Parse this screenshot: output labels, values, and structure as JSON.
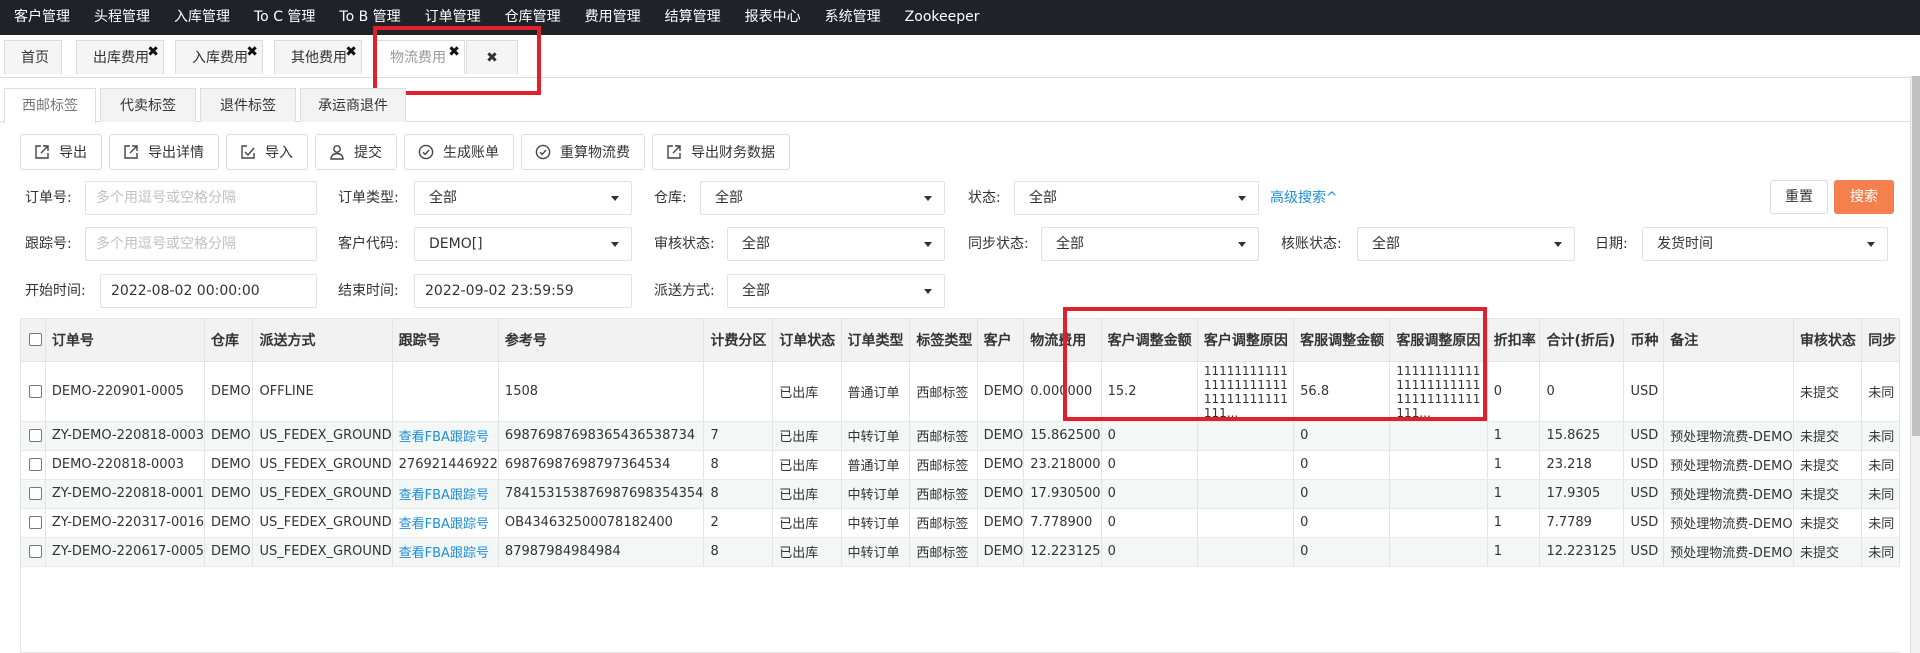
{
  "topnav": [
    "客户管理",
    "头程管理",
    "入库管理",
    "To C 管理",
    "To B 管理",
    "订单管理",
    "仓库管理",
    "费用管理",
    "结算管理",
    "报表中心",
    "系统管理",
    "Zookeeper"
  ],
  "pagetabs": {
    "home": "首页",
    "items": [
      "出库费用",
      "入库费用",
      "其他费用",
      "物流费用"
    ],
    "close_glyph": "✖"
  },
  "subtabs": [
    "西邮标签",
    "代卖标签",
    "退件标签",
    "承运商退件"
  ],
  "toolbar": [
    "导出",
    "导出详情",
    "导入",
    "提交",
    "生成账单",
    "重算物流费",
    "导出财务数据"
  ],
  "filters": {
    "order_no": {
      "label": "订单号:",
      "placeholder": "多个用逗号或空格分隔"
    },
    "order_type": {
      "label": "订单类型:",
      "value": "全部"
    },
    "warehouse": {
      "label": "仓库:",
      "value": "全部"
    },
    "status": {
      "label": "状态:",
      "value": "全部"
    },
    "advanced": "高级搜索^",
    "reset": "重置",
    "search": "搜索",
    "tracking_no": {
      "label": "跟踪号:",
      "placeholder": "多个用逗号或空格分隔"
    },
    "customer_code": {
      "label": "客户代码:",
      "value": "DEMO[]"
    },
    "audit_status": {
      "label": "审核状态:",
      "value": "全部"
    },
    "sync_status": {
      "label": "同步状态:",
      "value": "全部"
    },
    "reconcile_status": {
      "label": "核账状态:",
      "value": "全部"
    },
    "date": {
      "label": "日期:",
      "value": "发货时间"
    },
    "start_time": {
      "label": "开始时间:",
      "value": "2022-08-02 00:00:00"
    },
    "end_time": {
      "label": "结束时间:",
      "value": "2022-09-02 23:59:59"
    },
    "delivery_method": {
      "label": "派送方式:",
      "value": "全部"
    }
  },
  "table": {
    "columns": [
      "订单号",
      "仓库",
      "派送方式",
      "跟踪号",
      "参考号",
      "计费分区",
      "订单状态",
      "订单类型",
      "标签类型",
      "客户",
      "物流费用",
      "客户调整金额",
      "客户调整原因",
      "客服调整金额",
      "客服调整原因",
      "折扣率",
      "合计(折后)",
      "币种",
      "备注",
      "审核状态",
      "同步"
    ],
    "rows": [
      [
        "DEMO-220901-0005",
        "DEMO",
        "OFFLINE",
        "",
        "1508",
        "",
        "已出库",
        "普通订单",
        "西邮标签",
        "DEMO",
        "0.000000",
        "15.2",
        "111111111111111111111111111111111111...",
        "56.8",
        "111111111111111111111111111111111111...",
        "0",
        "0",
        "USD",
        "",
        "未提交",
        "未同"
      ],
      [
        "ZY-DEMO-220818-0003",
        "DEMO",
        "US_FEDEX_GROUND",
        "查看FBA跟踪号",
        "698769876983654365387​34",
        "7",
        "已出库",
        "中转订单",
        "西邮标签",
        "DEMO",
        "15.862500",
        "0",
        "",
        "0",
        "",
        "1",
        "15.8625",
        "USD",
        "预处理物流费-DEMO",
        "未提交",
        "未同"
      ],
      [
        "DEMO-220818-0003",
        "DEMO",
        "US_FEDEX_GROUND",
        "276921446922",
        "69876987698797364534",
        "8",
        "已出库",
        "普通订单",
        "西邮标签",
        "DEMO",
        "23.218000",
        "0",
        "",
        "0",
        "",
        "1",
        "23.218",
        "USD",
        "预处理物流费-DEMO",
        "未提交",
        "未同"
      ],
      [
        "ZY-DEMO-220818-0001",
        "DEMO",
        "US_FEDEX_GROUND",
        "查看FBA跟踪号",
        "78415315387698769835​4354",
        "8",
        "已出库",
        "中转订单",
        "西邮标签",
        "DEMO",
        "17.930500",
        "0",
        "",
        "0",
        "",
        "1",
        "17.9305",
        "USD",
        "预处理物流费-DEMO",
        "未提交",
        "未同"
      ],
      [
        "ZY-DEMO-220317-0016",
        "DEMO",
        "US_FEDEX_GROUND",
        "查看FBA跟踪号",
        "OB434632500078182400",
        "2",
        "已出库",
        "中转订单",
        "西邮标签",
        "DEMO",
        "7.778900",
        "0",
        "",
        "0",
        "",
        "1",
        "7.7789",
        "USD",
        "预处理物流费-DEMO",
        "未提交",
        "未同"
      ],
      [
        "ZY-DEMO-220617-0005",
        "DEMO",
        "US_FEDEX_GROUND",
        "查看FBA跟踪号",
        "87987984984984",
        "8",
        "已出库",
        "中转订单",
        "西邮标签",
        "DEMO",
        "12.223125",
        "0",
        "",
        "0",
        "",
        "1",
        "12.223125",
        "USD",
        "预处理物流费-DEMO",
        "未提交",
        "未同"
      ]
    ]
  },
  "colors": {
    "accent": "#f5804e",
    "link": "#1f8fd8",
    "highlight": "#e0202c",
    "nav": "#1f2329"
  }
}
